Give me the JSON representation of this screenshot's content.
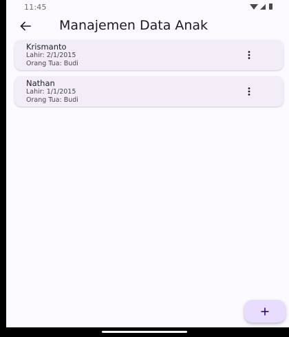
{
  "status_bar": {
    "time": "11:45",
    "icons": [
      "wifi-icon",
      "signal-icon",
      "battery-icon"
    ]
  },
  "app_bar": {
    "title": "Manajemen Data Anak",
    "back_icon": "arrow-back-icon"
  },
  "children": [
    {
      "name": "Krismanto",
      "birth": "Lahir: 2/1/2015",
      "parent": "Orang Tua: Budi",
      "menu_icon": "more-vert-icon"
    },
    {
      "name": "Nathan",
      "birth": "Lahir: 1/1/2015",
      "parent": "Orang Tua: Budi",
      "menu_icon": "more-vert-icon"
    }
  ],
  "fab": {
    "icon": "plus-icon"
  },
  "colors": {
    "background": "#fcf9ff",
    "card": "#f3edf7",
    "fab": "#e9ddff",
    "text_primary": "#1d1b20",
    "text_secondary": "#49454f"
  }
}
